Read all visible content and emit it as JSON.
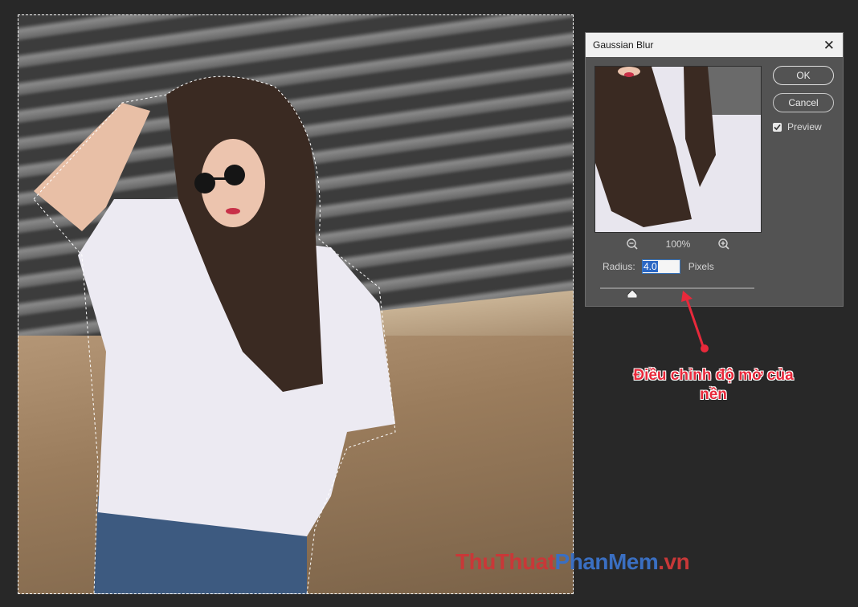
{
  "dialog": {
    "title": "Gaussian Blur",
    "ok_label": "OK",
    "cancel_label": "Cancel",
    "preview_label": "Preview",
    "preview_checked": true,
    "zoom_level": "100%",
    "radius_label": "Radius:",
    "radius_value": "4.0",
    "radius_unit": "Pixels"
  },
  "annotation": {
    "line1": "Điều chỉnh độ mờ của",
    "line2": "nền",
    "color": "#e8293b"
  },
  "watermark": {
    "part1": "ThuThuat",
    "part2": "PhanMem",
    "part3": ".vn"
  },
  "icons": {
    "zoom_out": "zoom-out-icon",
    "zoom_in": "zoom-in-icon",
    "close": "close-icon",
    "checkbox": "checkmark-icon"
  }
}
